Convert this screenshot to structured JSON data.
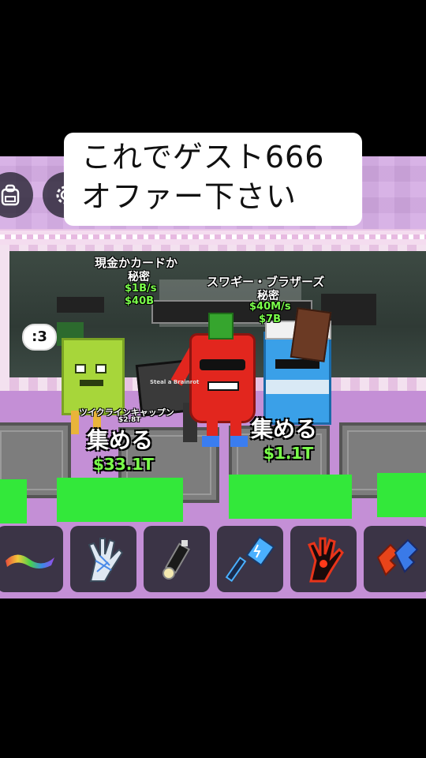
{
  "caption": {
    "line1": "これでゲスト666",
    "line2": "オファー下さい"
  },
  "hud": {
    "backpack_icon": "backpack-icon",
    "settings_icon": "gear-icon",
    "chat_bubble_text": ":3"
  },
  "sign": {
    "text": "Steal a Brainrot"
  },
  "brainrots": [
    {
      "name": "現金かカードか",
      "rarity": "秘密",
      "rate": "$1B/s",
      "price": "$40B"
    },
    {
      "name": "スワギー・ブラザーズ",
      "rarity": "秘密",
      "rate": "$40M/s",
      "price": "$7B"
    },
    {
      "name": "ツイクラインキャップン",
      "rarity": "",
      "rate": "",
      "price": "$2.8T"
    }
  ],
  "collect_pads": [
    {
      "label": "集める",
      "amount": "$33.1T"
    },
    {
      "label": "集める",
      "amount": "$1.1T"
    }
  ],
  "hotbar": {
    "slots": [
      {
        "name": "rainbow-carpet-icon"
      },
      {
        "name": "web-glove-icon"
      },
      {
        "name": "flashlight-icon"
      },
      {
        "name": "electric-hammer-icon"
      },
      {
        "name": "red-glove-icon"
      },
      {
        "name": "red-blue-item-icon"
      }
    ]
  },
  "colors": {
    "money_green": "#7aff4a",
    "pad_green": "#33e83a",
    "floor_purple": "#c48fd6"
  }
}
